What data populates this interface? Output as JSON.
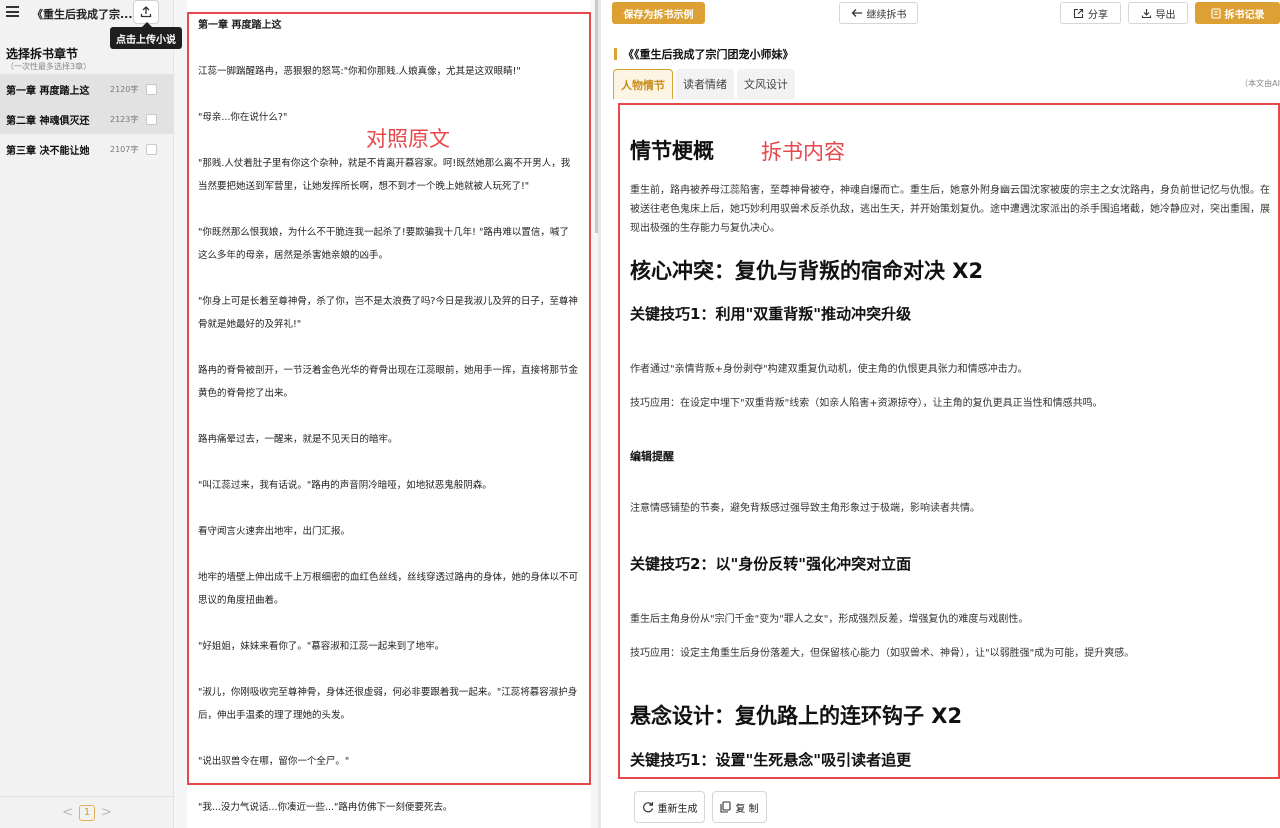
{
  "sidebar": {
    "book_title": "《重生后我成了宗...",
    "upload_tooltip": "点击上传小说",
    "heading": "选择拆书章节",
    "subheading": "（一次性最多选择3章）",
    "chapters": [
      {
        "name": "第一章 再度踏上这",
        "count": "2120字"
      },
      {
        "name": "第二章 神魂俱灭还",
        "count": "2123字"
      },
      {
        "name": "第三章 决不能让她",
        "count": "2107字"
      }
    ],
    "pager": {
      "prev": "<",
      "page": "1",
      "next": ">"
    }
  },
  "original": {
    "label": "对照原文",
    "chapter_title": "第一章 再度踏上这",
    "paragraphs": [
      "江蕊一脚踹醒路冉，恶狠狠的怒骂:\"你和你那贱.人娘真像，尤其是这双眼睛!\"",
      "\"母亲...你在说什么?\"",
      "\"那贱.人仗着肚子里有你这个杂种，就是不肯离开慕容家。呵!既然她那么离不开男人，我当然要把她送到军营里，让她发挥所长啊，想不到才一个晚上她就被人玩死了!\"",
      "\"你既然那么恨我娘，为什么不干脆连我一起杀了!要欺骗我十几年! \"路冉难以置信，喊了这么多年的母亲，居然是杀害她亲娘的凶手。",
      "\"你身上可是长着至尊神骨，杀了你，岂不是太浪费了吗?今日是我淑儿及笄的日子，至尊神骨就是她最好的及笄礼!\"",
      "路冉的脊骨被剖开，一节泛着金色光华的脊骨出现在江蕊眼前，她用手一挥，直接将那节金黄色的脊骨挖了出来。",
      "路冉痛晕过去，一醒来，就是不见天日的暗牢。",
      "\"叫江蕊过来，我有话说。\"路冉的声音阴冷暗哑，如地狱恶鬼般阴森。",
      "看守闻言火速奔出地牢，出门汇报。",
      "地牢的墙壁上伸出成千上万根细密的血红色丝线，丝线穿透过路冉的身体，她的身体以不可思议的角度扭曲着。",
      "\"好姐姐，妹妹来看你了。\"慕容淑和江蕊一起来到了地牢。",
      "\"淑儿，你刚吸收完至尊神骨，身体还很虚弱，何必非要跟着我一起来。\"江蕊将慕容淑护身后，伸出手温柔的理了理她的头发。",
      "\"说出驭兽令在哪，留你一个全尸。\"",
      "\"我...没力气说话...你凑近一些...\"路冉仿佛下一刻便要死去。"
    ]
  },
  "toolbar": {
    "save_example": "保存为拆书示例",
    "continue": "继续拆书",
    "share": "分享",
    "export": "导出",
    "record": "拆书记录"
  },
  "book_title": "《《重生后我成了宗门团宠小师妹》",
  "tabs": [
    "人物情节",
    "读者情绪",
    "文风设计"
  ],
  "ai_note": "（本文由AI",
  "analysis": {
    "label": "拆书内容",
    "plot_heading": "情节梗概",
    "plot_text": "重生前，路冉被养母江蕊陷害，至尊神骨被夺，神魂自爆而亡。重生后，她意外附身幽云国沈家被废的宗主之女沈路冉，身负前世记忆与仇恨。在被送往老色鬼床上后，她巧妙利用驭兽术反杀仇敌，逃出生天，并开始策划复仇。途中遭遇沈家派出的杀手围追堵截，她冷静应对，突出重围，展现出极强的生存能力与复仇决心。",
    "conflict_heading": "核心冲突：复仇与背叛的宿命对决 X2",
    "tip1_heading": "关键技巧1：利用\"双重背叛\"推动冲突升级",
    "tip1_text1": "作者通过\"亲情背叛+身份剥夺\"构建双重复仇动机，使主角的仇恨更具张力和情感冲击力。",
    "tip1_text2": "技巧应用：在设定中埋下\"双重背叛\"线索（如亲人陷害+资源掠夺），让主角的复仇更具正当性和情感共鸣。",
    "editor_heading": "编辑提醒",
    "editor_text": "注意情感铺垫的节奏，避免背叛感过强导致主角形象过于极端，影响读者共情。",
    "tip2_heading": "关键技巧2：以\"身份反转\"强化冲突对立面",
    "tip2_text1": "重生后主角身份从\"宗门千金\"变为\"罪人之女\"，形成强烈反差，增强复仇的难度与戏剧性。",
    "tip2_text2": "技巧应用：设定主角重生后身份落差大，但保留核心能力（如驭兽术、神骨），让\"以弱胜强\"成为可能，提升爽感。",
    "suspense_heading": "悬念设计：复仇路上的连环钩子 X2",
    "tip3_heading": "关键技巧1：设置\"生死悬念\"吸引读者追更"
  },
  "bottom": {
    "regenerate": "重新生成",
    "copy": "复 制"
  },
  "colors": {
    "accent": "#dca034",
    "annotation_red": "#e8474b"
  }
}
